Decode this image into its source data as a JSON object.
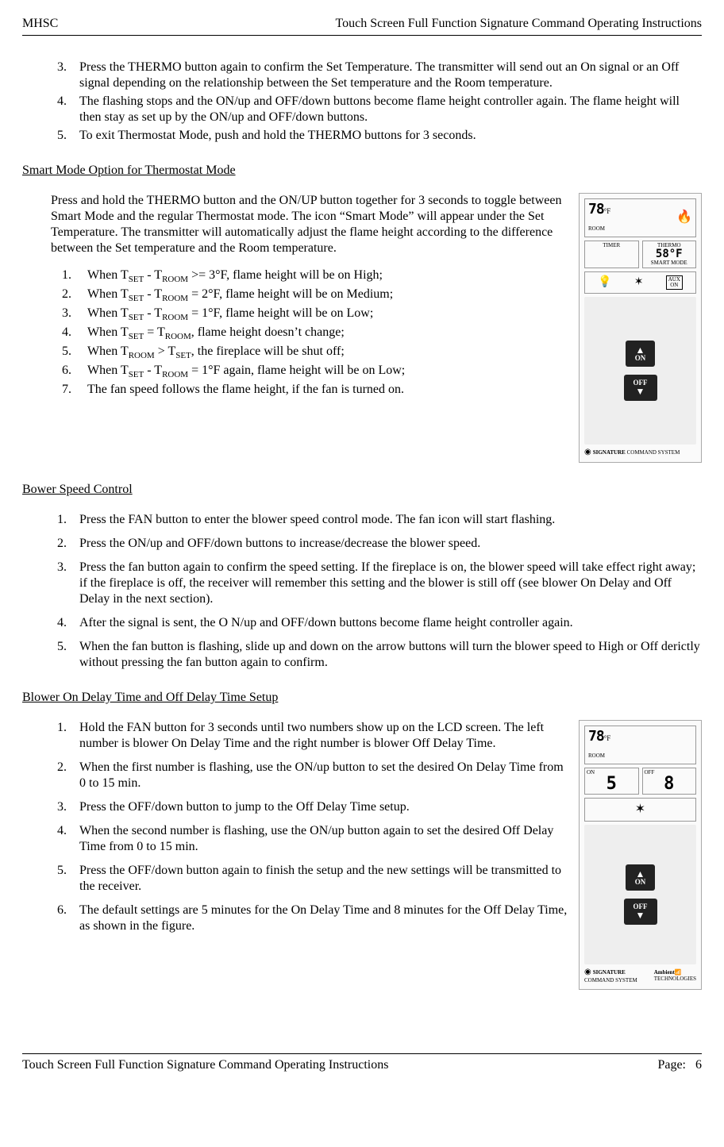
{
  "header": {
    "left": "MHSC",
    "right": "Touch Screen Full Function Signature Command Operating Instructions"
  },
  "top_list": {
    "start": 3,
    "items": [
      "Press the THERMO button again to confirm the Set Temperature. The transmitter will send out an On signal or an Off signal depending on the relationship between the Set temperature and the Room temperature.",
      "The flashing stops and the ON/up and OFF/down buttons become flame height controller again. The flame height will then stay as set up by the ON/up and OFF/down buttons.",
      "To exit Thermostat Mode, push and hold the THERMO buttons for 3 seconds."
    ]
  },
  "smart_mode": {
    "heading": "Smart Mode Option for Thermostat Mode",
    "para": "Press and hold the THERMO button and the ON/UP button together for 3 seconds to toggle between Smart Mode and the regular Thermostat mode. The icon “Smart Mode” will appear under the Set Temperature. The transmitter will automatically adjust the flame height according to the difference between the Set temperature and the Room temperature.",
    "rules": [
      {
        "pre": "When T",
        "s1": "SET",
        "mid": " - T",
        "s2": "ROOM",
        "post": " >= 3°F, flame height will be on High;"
      },
      {
        "pre": "When T",
        "s1": "SET",
        "mid": " - T",
        "s2": "ROOM",
        "post": " = 2°F, flame height will be on Medium;"
      },
      {
        "pre": "When T",
        "s1": "SET",
        "mid": " - T",
        "s2": "ROOM",
        "post": " = 1°F, flame height will be on Low;"
      },
      {
        "pre": "When T",
        "s1": "SET",
        "mid": " = T",
        "s2": "ROOM",
        "post": ", flame height doesn’t change;"
      },
      {
        "pre": "When T",
        "s1": "ROOM",
        "mid": " > T",
        "s2": "SET",
        "post": ", the fireplace will be shut off;"
      },
      {
        "pre": "When T",
        "s1": "SET",
        "mid": " - T",
        "s2": "ROOM",
        "post": " = 1°F again, flame height will be on Low;"
      },
      {
        "plain": "The fan speed follows the flame height, if the fan is turned on."
      }
    ]
  },
  "blower_speed": {
    "heading": "Bower Speed Control",
    "items": [
      "Press the FAN button to enter the blower speed control mode. The fan icon will start flashing.",
      "Press the ON/up and OFF/down buttons to increase/decrease the blower speed.",
      "Press the fan button again to confirm the speed setting.  If the fireplace is on, the blower speed will take effect right away; if the fireplace is off, the receiver will remember this setting and the blower is still off (see blower On Delay and Off Delay in the next section).",
      "After the signal is sent, the O N/up and OFF/down buttons become flame height controller again.",
      "When the fan button is flashing, slide up and down on the arrow buttons will turn the blower speed to High or Off derictly without pressing the fan button again to confirm."
    ]
  },
  "delay": {
    "heading": "Blower On Delay Time and Off Delay Time Setup",
    "items": [
      "Hold the FAN button for 3 seconds until two numbers show up on the LCD screen. The left number is blower On Delay Time and the right number is blower Off Delay Time.",
      "When the first number is flashing, use the ON/up button to set the desired On Delay Time from 0 to 15 min.",
      "Press the OFF/down button to jump to the Off Delay Time setup.",
      "When the second number is flashing, use the ON/up button again to set the desired Off Delay Time from 0 to 15 min.",
      "Press the OFF/down button again to finish the setup and the new settings will be transmitted to the receiver.",
      "The default settings are 5 minutes for the On Delay Time and 8 minutes for the Off Delay Time, as shown in the figure."
    ]
  },
  "remote1": {
    "temp": "78",
    "unit": "°F",
    "room": "ROOM",
    "timer": "TIMER",
    "thermo": "THERMO",
    "set_temp": "58°F",
    "smart": "SMART MODE",
    "aux": "AUX",
    "aux_on": "ON",
    "on": "ON",
    "off": "OFF",
    "brand1": "SIGNATURE",
    "brand1b": "COMMAND SYSTEM"
  },
  "remote2": {
    "temp": "78",
    "unit": "°F",
    "room": "ROOM",
    "on_lbl": "ON",
    "off_lbl": "OFF",
    "on_delay": "5",
    "off_delay": "8",
    "on": "ON",
    "off": "OFF",
    "brand1": "SIGNATURE",
    "brand1b": "COMMAND SYSTEM",
    "brand2": "Ambient",
    "brand2b": "TECHNOLOGIES"
  },
  "footer": {
    "left": "Touch Screen Full Function Signature Command Operating Instructions",
    "page_label": "Page:",
    "page_num": "6"
  }
}
